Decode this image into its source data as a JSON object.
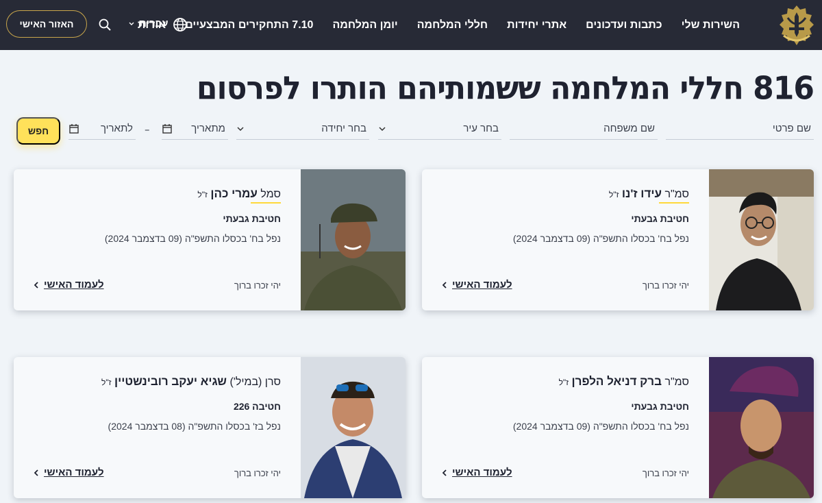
{
  "nav": {
    "items": [
      "השירות שלי",
      "כתבות ועדכונים",
      "אתרי יחידות",
      "חללי המלחמה",
      "יומן המלחמה",
      "7.10 התחקירים המבצעיים",
      "אודות"
    ],
    "language": "עברית",
    "personal_area": "האזור האישי"
  },
  "page": {
    "title": "816 חללי המלחמה ששמותיהם הותרו לפרסום"
  },
  "filters": {
    "first_name": "שם פרטי",
    "last_name": "שם משפחה",
    "city": "בחר עיר",
    "unit": "בחר יחידה",
    "from_date": "מתאריך",
    "to_date": "לתאריך",
    "search": "חפש"
  },
  "cards": [
    {
      "rank": "סמ\"ר",
      "name": "עידו ז'נו",
      "zl": "ז\"ל",
      "unit": "חטיבת גבעתי",
      "date": "נפל בח' בכסלו התשפ\"ה (09 בדצמבר 2024)",
      "remember": "יהי זכרו ברוך",
      "link": "לעמוד האישי"
    },
    {
      "rank": "סמל",
      "name": "עמרי כהן",
      "zl": "ז\"ל",
      "unit": "חטיבת גבעתי",
      "date": "נפל בח' בכסלו התשפ\"ה (09 בדצמבר 2024)",
      "remember": "יהי זכרו ברוך",
      "link": "לעמוד האישי"
    },
    {
      "rank": "סמ\"ר",
      "name": "ברק דניאל הלפרן",
      "zl": "ז\"ל",
      "unit": "חטיבת גבעתי",
      "date": "נפל בח' בכסלו התשפ\"ה (09 בדצמבר 2024)",
      "remember": "יהי זכרו ברוך",
      "link": "לעמוד האישי"
    },
    {
      "rank": "סרן (במיל')",
      "name": "שגיא יעקב רובינשטיין",
      "zl": "ז\"ל",
      "unit": "חטיבה 226",
      "date": "נפל בז' בכסלו התשפ\"ה (08 בדצמבר 2024)",
      "remember": "יהי זכרו ברוך",
      "link": "לעמוד האישי"
    }
  ],
  "colors": {
    "header_bg": "#272a36",
    "accent_yellow": "#ffe15a",
    "gold": "#c9a64b",
    "page_bg": "#f0f4f8"
  }
}
